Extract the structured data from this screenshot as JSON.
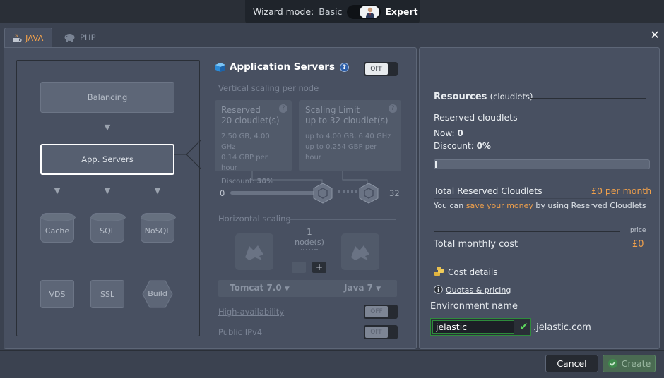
{
  "wizard": {
    "label": "Wizard mode:",
    "basic": "Basic",
    "expert": "Expert"
  },
  "tabs": [
    {
      "label": "JAVA"
    },
    {
      "label": "PHP"
    }
  ],
  "topology": {
    "balancing": "Balancing",
    "app_servers": "App. Servers",
    "cache": "Cache",
    "sql": "SQL",
    "nosql": "NoSQL",
    "vds": "VDS",
    "ssl": "SSL",
    "build": "Build"
  },
  "app_servers": {
    "title": "Application Servers",
    "switch": "OFF",
    "vertical_label": "Vertical scaling per node",
    "reserved": {
      "title": "Reserved",
      "value": "20 cloudlet(s)",
      "spec": "2.50 GB, 4.00 GHz",
      "price": "0.14 GBP per hour",
      "discount_label": "Discount:",
      "discount": "30%"
    },
    "limit": {
      "title": "Scaling Limit",
      "value": "up to 32 cloudlet(s)",
      "spec": "up to 4.00 GB, 6.40 GHz",
      "price": "up to 0.254 GBP per hour"
    },
    "slider_min": "0",
    "slider_max": "32",
    "horizontal_label": "Horizontal scaling",
    "nodes_count": "1",
    "nodes_label": "node(s)",
    "minus": "−",
    "plus": "+",
    "server": "Tomcat 7.0",
    "java": "Java 7",
    "ha_label": "High-availability",
    "ha_switch": "OFF",
    "ipv4_label": "Public IPv4",
    "ipv4_switch": "OFF"
  },
  "resources": {
    "title": "Resources",
    "title_sub": "(cloudlets)",
    "reserved_label": "Reserved cloudlets",
    "now_label": "Now:",
    "now_value": "0",
    "discount_label": "Discount:",
    "discount_value": "0%",
    "progress": 0,
    "total_reserved_label": "Total Reserved Cloudlets",
    "total_reserved_value": "£0 per month",
    "save_pre": "You can",
    "save_link": "save your money",
    "save_post": "by using Reserved Cloudlets",
    "price_label": "price",
    "monthly_label": "Total monthly cost",
    "monthly_value": "£0",
    "cost_details": "Cost details",
    "quotas": "Quotas & pricing"
  },
  "environment": {
    "label": "Environment name",
    "value": "jelastic",
    "domain": ".jelastic.com"
  },
  "buttons": {
    "cancel": "Cancel",
    "create": "Create"
  }
}
